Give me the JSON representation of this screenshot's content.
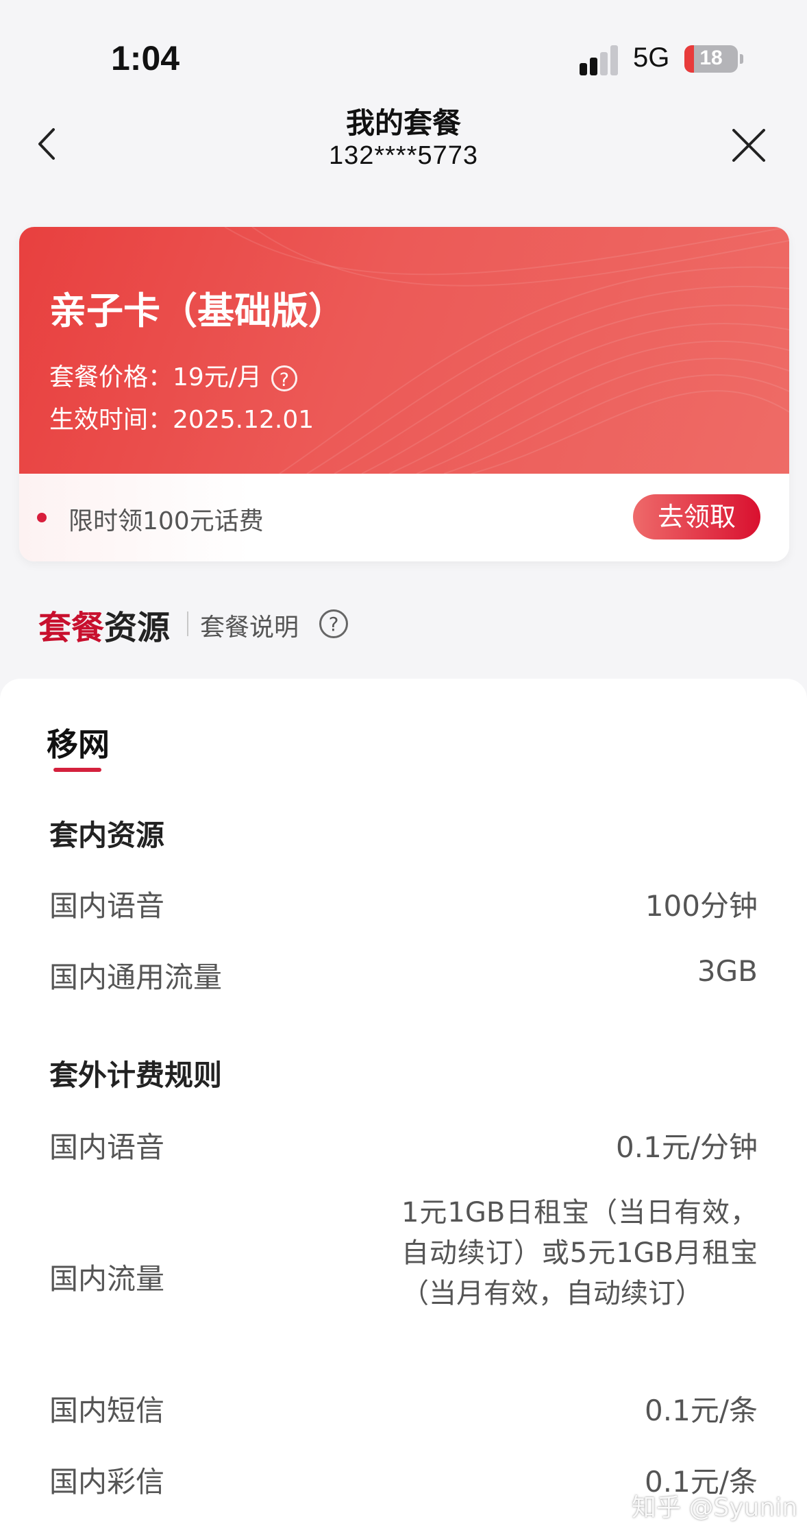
{
  "status_bar": {
    "time": "1:04",
    "network": "5G",
    "battery_level": "18",
    "battery_fraction": 0.18,
    "battery_color": "#e83b3b"
  },
  "nav": {
    "title": "我的套餐",
    "phone": "132****5773",
    "back_icon": "chevron-left-icon",
    "close_icon": "close-icon"
  },
  "plan": {
    "name": "亲子卡（基础版）",
    "price_label": "套餐价格：",
    "price_value": "19元/月",
    "help_icon_glyph": "?",
    "date_label": "生效时间：",
    "date_value": "2025.12.01",
    "card_color": "#e8403f"
  },
  "promo": {
    "text": "限时领100元话费",
    "button": "去领取",
    "accent": "#d81e3c"
  },
  "section": {
    "title_part1": "套餐",
    "title_part2": "资源",
    "link": "套餐说明",
    "help_glyph": "?"
  },
  "tab": {
    "label": "移网"
  },
  "included": {
    "heading": "套内资源",
    "rows": [
      {
        "label": "国内语音",
        "value": "100分钟"
      },
      {
        "label": "国内通用流量",
        "value": "3GB"
      }
    ]
  },
  "overage": {
    "heading": "套外计费规则",
    "rows": [
      {
        "label": "国内语音",
        "value": "0.1元/分钟"
      },
      {
        "label": "国内流量",
        "value": "1元1GB日租宝（当日有效，自动续订）或5元1GB月租宝（当月有效，自动续订）"
      },
      {
        "label": "国内短信",
        "value": "0.1元/条"
      },
      {
        "label": "国内彩信",
        "value": "0.1元/条"
      }
    ]
  },
  "watermark": "知乎 @Syunin"
}
